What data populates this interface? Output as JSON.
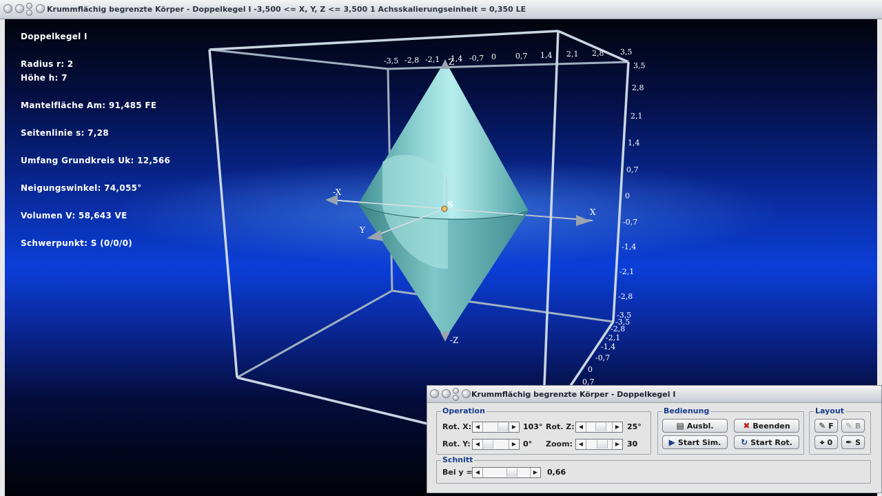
{
  "window": {
    "title": "Krummflächig begrenzte Körper - Doppelkegel I   -3,500 <= X, Y, Z <= 3,500    1 Achsskalierungseinheit = 0,350 LE"
  },
  "info": {
    "heading": "Doppelkegel I",
    "radius": "Radius r: 2",
    "hoehe": "Höhe h: 7",
    "mantel": "Mantelfläche Am: 91,485 FE",
    "seitenlinie": "Seitenlinie s: 7,28",
    "umfang": "Umfang Grundkreis Uk: 12,566",
    "winkel": "Neigungswinkel: 74,055°",
    "volumen": "Volumen V: 58,643 VE",
    "schwerpunkt": "Schwerpunkt: S (0/0/0)"
  },
  "scene": {
    "top_ticks": [
      "-3,5",
      "-2,8",
      "-2,1",
      "-1,4",
      "-0,7",
      "0",
      "0,7",
      "1,4",
      "2,1",
      "2,8",
      "3,5"
    ],
    "right_ticks": [
      "3,5",
      "2,8",
      "2,1",
      "1,4",
      "0,7",
      "0",
      "-0,7",
      "-1,4",
      "-2,1",
      "-2,8",
      "-3,5"
    ],
    "bottom_ticks": [
      "-3,5",
      "-2,8",
      "-2,1",
      "-1,4",
      "-0,7",
      "0",
      "0,7"
    ],
    "axis_labels": {
      "x_neg": "-X",
      "x_pos": "X",
      "y": "Y",
      "z_top": "Z",
      "z_neg": "-Z",
      "center": "S"
    },
    "colors": {
      "solid": "#7fc9cc",
      "frame": "#c8d6e4"
    }
  },
  "dialog": {
    "title": "Krummflächig begrenzte Körper - Doppelkegel I",
    "operation": {
      "label": "Operation",
      "rot_x_label": "Rot. X:",
      "rot_x_value": "103°",
      "rot_y_label": "Rot. Y:",
      "rot_y_value": "0°",
      "rot_z_label": "Rot. Z:",
      "rot_z_value": "25°",
      "zoom_label": "Zoom:",
      "zoom_value": "30"
    },
    "bedienung": {
      "label": "Bedienung",
      "ausbl": "Ausbl.",
      "beenden": "Beenden",
      "start_sim": "Start Sim.",
      "start_rot": "Start Rot."
    },
    "layout": {
      "label": "Layout",
      "f": "F",
      "b": "B",
      "o": "0",
      "s": "S"
    },
    "schnitt": {
      "label": "Schnitt",
      "bei_y_label": "Bei y =",
      "bei_y_value": "0,66"
    }
  }
}
